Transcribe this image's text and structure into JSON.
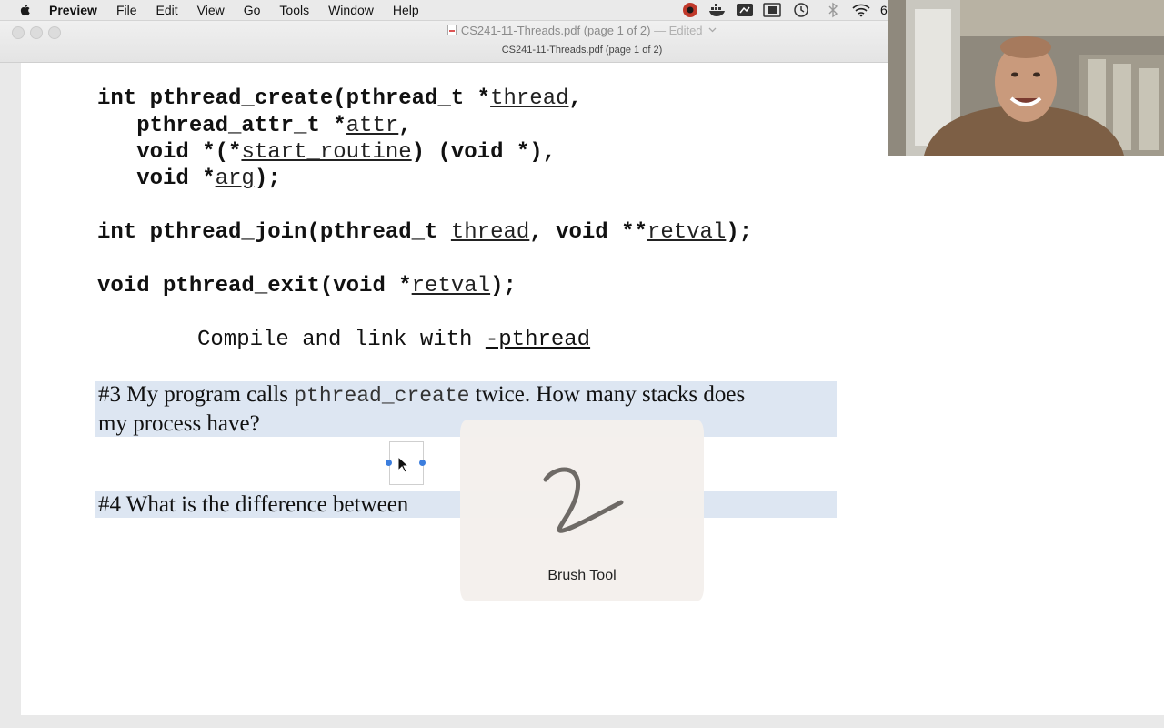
{
  "menubar": {
    "items": [
      "Preview",
      "File",
      "Edit",
      "View",
      "Go",
      "Tools",
      "Window",
      "Help"
    ],
    "clock_partial": "6"
  },
  "window": {
    "title": "CS241-11-Threads.pdf (page 1 of 2)",
    "edited_suffix": "— Edited",
    "subtitle": "CS241-11-Threads.pdf (page 1 of 2)"
  },
  "content": {
    "line1_pre": "int pthread_create(pthread_t *",
    "line1_arg": "thread",
    "line1_post": ",",
    "line2_pre": "   pthread_attr_t *",
    "line2_arg": "attr",
    "line2_post": ",",
    "line3_pre": "   void *(*",
    "line3_arg": "start_routine",
    "line3_post": ") (void *),",
    "line4_pre": "   void *",
    "line4_arg": "arg",
    "line4_post": ");",
    "join_pre": "int pthread_join(pthread_t ",
    "join_arg1": "thread",
    "join_mid": ", void **",
    "join_arg2": "retval",
    "join_post": ");",
    "exit_pre": "void pthread_exit(void *",
    "exit_arg": "retval",
    "exit_post": ");",
    "compile_text": "Compile and link with ",
    "compile_flag": "-pthread",
    "q3_a": "#3 My program calls ",
    "q3_code": "pthread_create",
    "q3_b": " twice. How many stacks does",
    "q3_c": "my process have?",
    "q4": "#4 What is the difference between"
  },
  "brush_tool": {
    "label": "Brush Tool",
    "stroke_color": "#6e6a66"
  },
  "colors": {
    "highlight": "#dde6f2",
    "handle": "#3b7ddd"
  }
}
